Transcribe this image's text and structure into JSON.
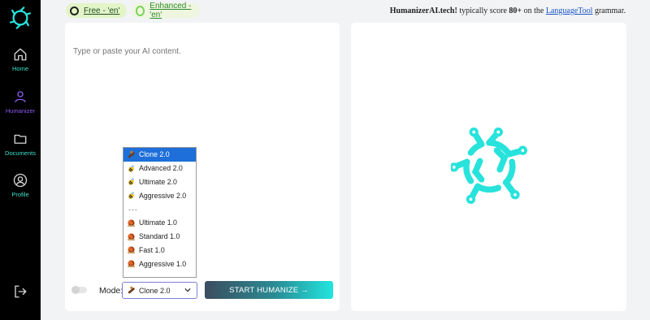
{
  "sidebar": {
    "items": [
      {
        "label": "Home",
        "icon": "home-icon"
      },
      {
        "label": "Humanizer",
        "icon": "user-icon"
      },
      {
        "label": "Documents",
        "icon": "folder-icon"
      },
      {
        "label": "Profile",
        "icon": "profile-icon"
      }
    ],
    "logout_icon": "logout-icon",
    "active": "Humanizer"
  },
  "topbar": {
    "free_label": "Free - 'en'",
    "enhanced_label": "Enhanced - 'en'",
    "note_brand": "HumanizerAI.tech!",
    "note_mid": " typically score ",
    "note_score": "80+",
    "note_on": " on the ",
    "note_link": "LanguageTool",
    "note_end": " grammar."
  },
  "editor": {
    "placeholder": "Type or paste your AI content.",
    "value": ""
  },
  "controls": {
    "mode_label": "Mode:",
    "selected_mode": "Clone 2.0",
    "humanize_button": "START HUMANIZE →"
  },
  "mode_options": [
    {
      "label": "Clone 2.0",
      "icon": "wrench-icon",
      "selected": true
    },
    {
      "label": "Advanced 2.0",
      "icon": "bee-icon"
    },
    {
      "label": "Ultimate 2.0",
      "icon": "bee-icon"
    },
    {
      "label": "Aggressive 2.0",
      "icon": "bee-icon"
    },
    {
      "label": "---",
      "separator": true
    },
    {
      "label": "Ultimate 1.0",
      "icon": "snail-icon"
    },
    {
      "label": "Standard 1.0",
      "icon": "snail-icon"
    },
    {
      "label": "Fast 1.0",
      "icon": "snail-icon"
    },
    {
      "label": "Aggressive 1.0",
      "icon": "snail-icon"
    },
    {
      "label": "---",
      "separator": true
    }
  ],
  "colors": {
    "accent": "#27e3dc",
    "sidebar_bg": "#000000",
    "active_nav": "#8b5cf6",
    "nav": "#39e0c8",
    "dropdown_selected": "#1e6fd9"
  }
}
